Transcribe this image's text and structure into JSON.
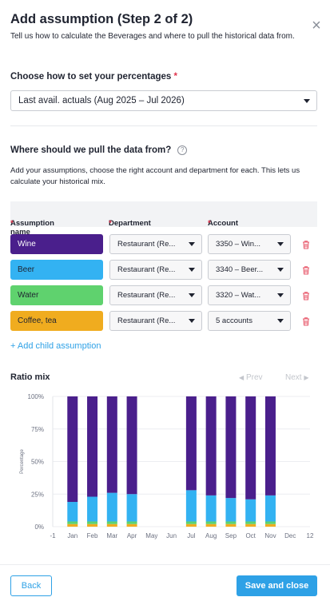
{
  "header": {
    "title": "Add assumption (Step 2 of 2)",
    "subtitle": "Tell us how to calculate the Beverages and where to pull the historical data from.",
    "close_icon": "close-icon"
  },
  "percentages": {
    "label": "Choose how to set your percentages",
    "required_mark": "*",
    "selected": "Last avail. actuals (Aug 2025 – Jul 2026)"
  },
  "data_source": {
    "heading": "Where should we pull the data from?",
    "help_icon": "question-circle-icon",
    "description": "Add your assumptions, choose the right account and department for each. This lets us calculate your historical mix."
  },
  "table": {
    "columns": [
      {
        "label": "Assumption name",
        "required": "*"
      },
      {
        "label": "Department",
        "required": "*"
      },
      {
        "label": "Account",
        "required": "*"
      }
    ],
    "rows": [
      {
        "name": "Wine",
        "color": "#4a1f8c",
        "text_color": "#ffffff",
        "department": "Restaurant (Re...",
        "account": "3350 – Win..."
      },
      {
        "name": "Beer",
        "color": "#33b2f2",
        "text_color": "#1f2330",
        "department": "Restaurant (Re...",
        "account": "3340 – Beer..."
      },
      {
        "name": "Water",
        "color": "#5fd26e",
        "text_color": "#1f2330",
        "department": "Restaurant (Re...",
        "account": "3320 – Wat..."
      },
      {
        "name": "Coffee, tea",
        "color": "#f0ac1f",
        "text_color": "#1f2330",
        "department": "Restaurant (Re...",
        "account": "5 accounts"
      }
    ],
    "add_child_label": "+ Add child assumption"
  },
  "ratio_mix": {
    "title": "Ratio mix",
    "prev_label": "Prev",
    "next_label": "Next"
  },
  "chart_data": {
    "type": "bar",
    "stacked": true,
    "ylabel": "Percentage",
    "ylim": [
      0,
      100
    ],
    "yticks": [
      "0%",
      "25%",
      "50%",
      "75%",
      "100%"
    ],
    "categories": [
      "-1",
      "Jan",
      "Feb",
      "Mar",
      "Apr",
      "May",
      "Jun",
      "Jul",
      "Aug",
      "Sep",
      "Oct",
      "Nov",
      "Dec",
      "12"
    ],
    "series": [
      {
        "name": "Coffee, tea",
        "color": "#f0ac1f",
        "values": [
          null,
          2,
          2,
          2,
          2,
          null,
          null,
          2,
          2,
          2,
          2,
          2,
          null,
          null
        ]
      },
      {
        "name": "Water",
        "color": "#5fd26e",
        "values": [
          null,
          2,
          2,
          2,
          2,
          null,
          null,
          2,
          2,
          2,
          2,
          2,
          null,
          null
        ]
      },
      {
        "name": "Beer",
        "color": "#33b2f2",
        "values": [
          null,
          15,
          19,
          22,
          21,
          null,
          null,
          24,
          20,
          18,
          17,
          20,
          null,
          null
        ]
      },
      {
        "name": "Wine",
        "color": "#4a1f8c",
        "values": [
          null,
          81,
          77,
          74,
          75,
          null,
          null,
          72,
          76,
          78,
          79,
          76,
          null,
          null
        ]
      }
    ],
    "grid": true,
    "legend": "none"
  },
  "footer": {
    "back_label": "Back",
    "save_label": "Save and close"
  }
}
